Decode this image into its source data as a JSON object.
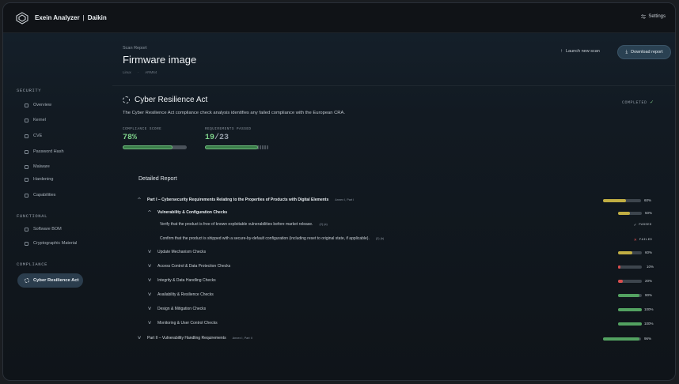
{
  "app": {
    "name": "Exein Analyzer",
    "org": "Daikin",
    "settings_label": "Settings"
  },
  "sidebar": {
    "sections": [
      {
        "heading": "SECURITY",
        "items": [
          "Overview",
          "Kernel",
          "CVE",
          "Password Hash",
          "Malware",
          "Hardening",
          "Capabilities"
        ]
      },
      {
        "heading": "FUNCTIONAL",
        "items": [
          "Software BOM",
          "Cryptographic Material"
        ]
      },
      {
        "heading": "COMPLIANCE",
        "items": [
          "Cyber Resilience Act"
        ]
      }
    ],
    "active": "Cyber Resilience Act"
  },
  "header": {
    "kicker": "Scan Report",
    "title": "Firmware image",
    "crumbs": [
      "Linux",
      "ARM64"
    ],
    "launch_label": "Launch new scan",
    "download_label": "Download report"
  },
  "cra": {
    "title": "Cyber Resilience Act",
    "status": "COMPLETED",
    "description": "The Cyber Resilience Act compliance check analysis identifies any failed compliance with the European CRA.",
    "compliance_label": "COMPLIANCE SCORE",
    "compliance_value": "78%",
    "compliance_fraction": 0.78,
    "requirements_label": "REQUIREMENTS PASSED",
    "requirements_passed": "19",
    "requirements_total": "/23",
    "requirements_fraction": 0.826
  },
  "report": {
    "title": "Detailed Report",
    "part1": {
      "label": "Part I – Cybersecurity Requirements Relating to the Properties of Products with Digital Elements",
      "annex": "Annex I, Part I",
      "percent": "60%",
      "fraction": 0.6
    },
    "vuln": {
      "label": "Vulnerability & Configuration Checks",
      "percent": "50%",
      "fraction": 0.5
    },
    "check1": {
      "label": "Verify that the product is free of known exploitable vulnerabilities before market release.",
      "ref": "(2) (a)",
      "status": "PASSED"
    },
    "check2": {
      "label": "Confirm that the product is shipped with a secure-by-default configuration (including reset to original state, if applicable).",
      "ref": "(2) (b)",
      "status": "FAILED"
    },
    "groups": [
      {
        "label": "Update Mechanism Checks",
        "percent": "60%",
        "fraction": 0.6,
        "color": "#b8a640"
      },
      {
        "label": "Access Control & Data Protection Checks",
        "percent": "10%",
        "fraction": 0.1,
        "color": "#d04a4a"
      },
      {
        "label": "Integrity & Data Handling Checks",
        "percent": "20%",
        "fraction": 0.2,
        "color": "#d04a4a"
      },
      {
        "label": "Availability & Resilience Checks",
        "percent": "90%",
        "fraction": 0.9,
        "color": "#4f9a5c"
      },
      {
        "label": "Design & Mitigation Checks",
        "percent": "100%",
        "fraction": 1.0,
        "color": "#4f9a5c"
      },
      {
        "label": "Monitoring & User Control Checks",
        "percent": "100%",
        "fraction": 1.0,
        "color": "#4f9a5c"
      }
    ],
    "part2": {
      "label": "Part II – Vulnerability Handling Requirements",
      "annex": "Annex I, Part II",
      "percent": "96%",
      "fraction": 0.96
    }
  },
  "colors": {
    "green": "#4f9a5c",
    "yellow": "#b8a640",
    "red": "#d04a4a",
    "accent": "#2a4152"
  }
}
